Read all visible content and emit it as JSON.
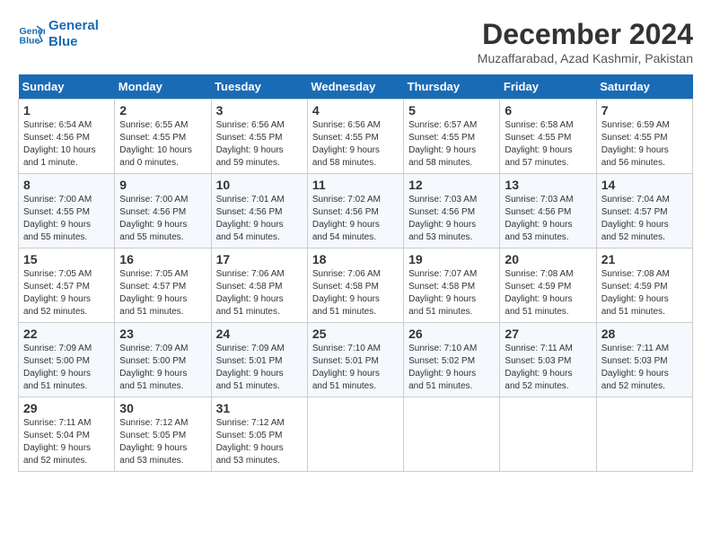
{
  "header": {
    "logo_line1": "General",
    "logo_line2": "Blue",
    "month_title": "December 2024",
    "location": "Muzaffarabad, Azad Kashmir, Pakistan"
  },
  "calendar": {
    "days_of_week": [
      "Sunday",
      "Monday",
      "Tuesday",
      "Wednesday",
      "Thursday",
      "Friday",
      "Saturday"
    ],
    "weeks": [
      [
        {
          "day": "1",
          "sunrise": "6:54 AM",
          "sunset": "4:56 PM",
          "daylight": "10 hours and 1 minute."
        },
        {
          "day": "2",
          "sunrise": "6:55 AM",
          "sunset": "4:55 PM",
          "daylight": "10 hours and 0 minutes."
        },
        {
          "day": "3",
          "sunrise": "6:56 AM",
          "sunset": "4:55 PM",
          "daylight": "9 hours and 59 minutes."
        },
        {
          "day": "4",
          "sunrise": "6:56 AM",
          "sunset": "4:55 PM",
          "daylight": "9 hours and 58 minutes."
        },
        {
          "day": "5",
          "sunrise": "6:57 AM",
          "sunset": "4:55 PM",
          "daylight": "9 hours and 58 minutes."
        },
        {
          "day": "6",
          "sunrise": "6:58 AM",
          "sunset": "4:55 PM",
          "daylight": "9 hours and 57 minutes."
        },
        {
          "day": "7",
          "sunrise": "6:59 AM",
          "sunset": "4:55 PM",
          "daylight": "9 hours and 56 minutes."
        }
      ],
      [
        {
          "day": "8",
          "sunrise": "7:00 AM",
          "sunset": "4:55 PM",
          "daylight": "9 hours and 55 minutes."
        },
        {
          "day": "9",
          "sunrise": "7:00 AM",
          "sunset": "4:56 PM",
          "daylight": "9 hours and 55 minutes."
        },
        {
          "day": "10",
          "sunrise": "7:01 AM",
          "sunset": "4:56 PM",
          "daylight": "9 hours and 54 minutes."
        },
        {
          "day": "11",
          "sunrise": "7:02 AM",
          "sunset": "4:56 PM",
          "daylight": "9 hours and 54 minutes."
        },
        {
          "day": "12",
          "sunrise": "7:03 AM",
          "sunset": "4:56 PM",
          "daylight": "9 hours and 53 minutes."
        },
        {
          "day": "13",
          "sunrise": "7:03 AM",
          "sunset": "4:56 PM",
          "daylight": "9 hours and 53 minutes."
        },
        {
          "day": "14",
          "sunrise": "7:04 AM",
          "sunset": "4:57 PM",
          "daylight": "9 hours and 52 minutes."
        }
      ],
      [
        {
          "day": "15",
          "sunrise": "7:05 AM",
          "sunset": "4:57 PM",
          "daylight": "9 hours and 52 minutes."
        },
        {
          "day": "16",
          "sunrise": "7:05 AM",
          "sunset": "4:57 PM",
          "daylight": "9 hours and 51 minutes."
        },
        {
          "day": "17",
          "sunrise": "7:06 AM",
          "sunset": "4:58 PM",
          "daylight": "9 hours and 51 minutes."
        },
        {
          "day": "18",
          "sunrise": "7:06 AM",
          "sunset": "4:58 PM",
          "daylight": "9 hours and 51 minutes."
        },
        {
          "day": "19",
          "sunrise": "7:07 AM",
          "sunset": "4:58 PM",
          "daylight": "9 hours and 51 minutes."
        },
        {
          "day": "20",
          "sunrise": "7:08 AM",
          "sunset": "4:59 PM",
          "daylight": "9 hours and 51 minutes."
        },
        {
          "day": "21",
          "sunrise": "7:08 AM",
          "sunset": "4:59 PM",
          "daylight": "9 hours and 51 minutes."
        }
      ],
      [
        {
          "day": "22",
          "sunrise": "7:09 AM",
          "sunset": "5:00 PM",
          "daylight": "9 hours and 51 minutes."
        },
        {
          "day": "23",
          "sunrise": "7:09 AM",
          "sunset": "5:00 PM",
          "daylight": "9 hours and 51 minutes."
        },
        {
          "day": "24",
          "sunrise": "7:09 AM",
          "sunset": "5:01 PM",
          "daylight": "9 hours and 51 minutes."
        },
        {
          "day": "25",
          "sunrise": "7:10 AM",
          "sunset": "5:01 PM",
          "daylight": "9 hours and 51 minutes."
        },
        {
          "day": "26",
          "sunrise": "7:10 AM",
          "sunset": "5:02 PM",
          "daylight": "9 hours and 51 minutes."
        },
        {
          "day": "27",
          "sunrise": "7:11 AM",
          "sunset": "5:03 PM",
          "daylight": "9 hours and 52 minutes."
        },
        {
          "day": "28",
          "sunrise": "7:11 AM",
          "sunset": "5:03 PM",
          "daylight": "9 hours and 52 minutes."
        }
      ],
      [
        {
          "day": "29",
          "sunrise": "7:11 AM",
          "sunset": "5:04 PM",
          "daylight": "9 hours and 52 minutes."
        },
        {
          "day": "30",
          "sunrise": "7:12 AM",
          "sunset": "5:05 PM",
          "daylight": "9 hours and 53 minutes."
        },
        {
          "day": "31",
          "sunrise": "7:12 AM",
          "sunset": "5:05 PM",
          "daylight": "9 hours and 53 minutes."
        },
        null,
        null,
        null,
        null
      ]
    ],
    "labels": {
      "sunrise": "Sunrise:",
      "sunset": "Sunset:",
      "daylight": "Daylight:"
    }
  }
}
